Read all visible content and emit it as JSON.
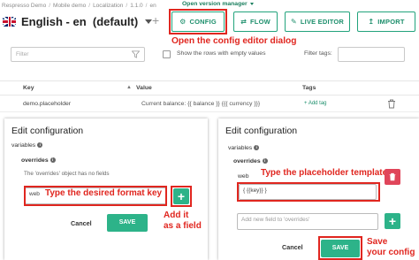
{
  "breadcrumb": [
    "Respresso Demo",
    "Mobile demo",
    "Localization",
    "1.1.0",
    "en"
  ],
  "version_manager": "Open version manager",
  "language": {
    "label": "English - en",
    "suffix": "(default)"
  },
  "add_lang_glyph": "+",
  "toolbar": {
    "config": "CONFIG",
    "flow": "FLOW",
    "live_editor": "LIVE EDITOR",
    "import": "IMPORT"
  },
  "annotations": {
    "config": "Open the config editor dialog",
    "format_key": "Type the desired format key",
    "add_field_line1": "Add it",
    "add_field_line2": "as a field",
    "placeholder_template": "Type the placeholder template",
    "save_line1": "Save",
    "save_line2": "your config"
  },
  "filter": {
    "placeholder": "Filter",
    "empty_rows_label": "Show the rows with empty values",
    "tags_label": "Filter tags:"
  },
  "table": {
    "headers": {
      "key": "Key",
      "value": "Value",
      "tags": "Tags"
    },
    "rows": [
      {
        "key": "demo.placeholder",
        "value": "Current balance: {{ balance }} {{{ currency }}}",
        "add_tag": "+ Add tag"
      }
    ]
  },
  "dialog_left": {
    "title": "Edit configuration",
    "variables": "variables",
    "overrides": "overrides",
    "empty_note": "The 'overrides' object has no fields",
    "key_value": "web",
    "cancel": "Cancel",
    "save": "SAVE"
  },
  "dialog_right": {
    "title": "Edit configuration",
    "variables": "variables",
    "overrides": "overrides",
    "field_label": "web",
    "template_value": "{ {{key}} }",
    "new_field_placeholder": "Add new field to 'overrides'",
    "cancel": "Cancel",
    "save": "SAVE"
  },
  "colors": {
    "accent": "#2db389",
    "annotation": "#e0261f",
    "danger": "#e0455a"
  }
}
